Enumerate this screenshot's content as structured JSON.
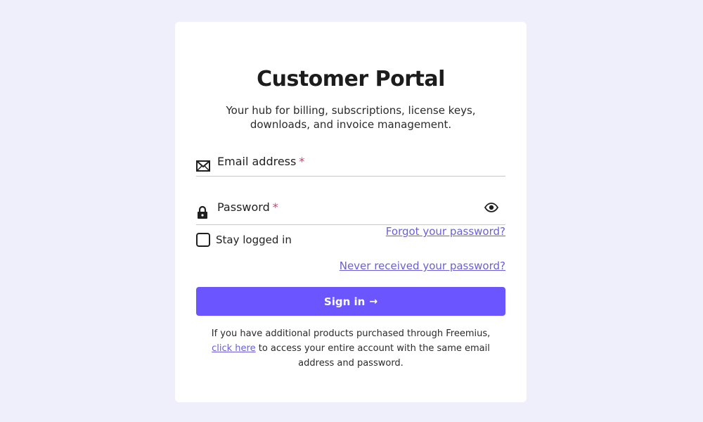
{
  "portal": {
    "title": "Customer Portal",
    "subtitle": "Your hub for billing, subscriptions, license keys, downloads, and invoice management."
  },
  "form": {
    "email": {
      "label": "Email address",
      "required_mark": "*",
      "value": "",
      "icon": "envelope-icon"
    },
    "password": {
      "label": "Password",
      "required_mark": "*",
      "value": "",
      "icon": "lock-icon",
      "toggle_icon": "eye-icon"
    },
    "stay_logged_in": {
      "label": "Stay logged in",
      "checked": false
    },
    "forgot_password_link": "Forgot your password?",
    "never_received_link": "Never received your password?",
    "sign_in_label": "Sign in",
    "sign_in_arrow": "→"
  },
  "footer": {
    "text_before": "If you have additional products purchased through Freemius, ",
    "link_text": "click here",
    "text_after": " to access your entire account with the same email address and password."
  },
  "colors": {
    "background": "#efeffb",
    "card": "#ffffff",
    "primary_button": "#6a55ff",
    "link": "#6a5fd8",
    "required": "#d43d6a"
  }
}
